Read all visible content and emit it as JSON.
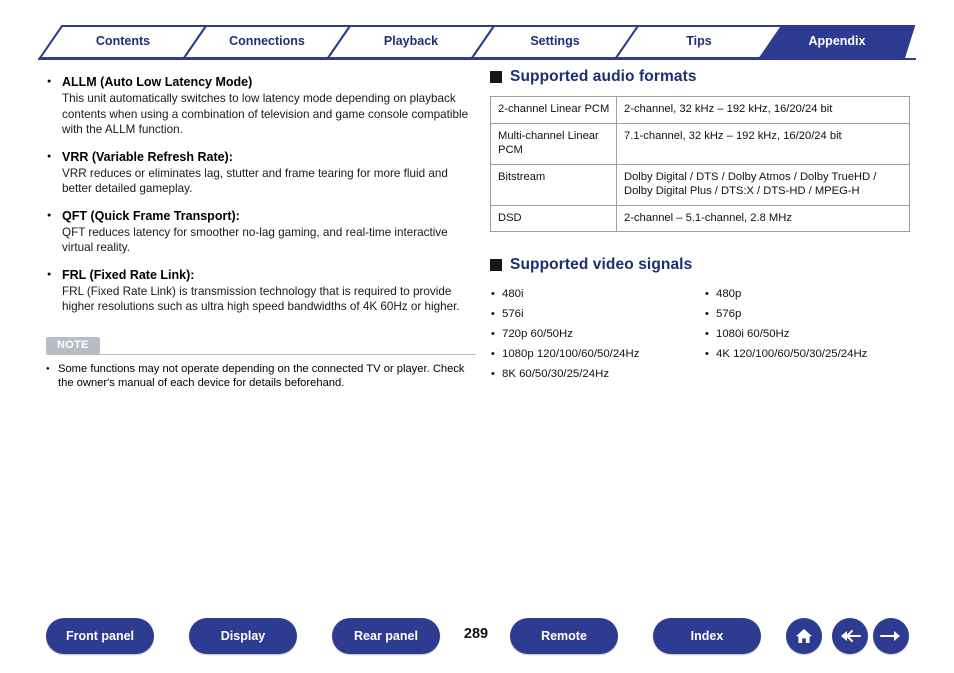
{
  "tabs": [
    {
      "label": "Contents",
      "active": false
    },
    {
      "label": "Connections",
      "active": false
    },
    {
      "label": "Playback",
      "active": false
    },
    {
      "label": "Settings",
      "active": false
    },
    {
      "label": "Tips",
      "active": false
    },
    {
      "label": "Appendix",
      "active": true
    }
  ],
  "left": {
    "bullets": [
      {
        "title": "ALLM (Auto Low Latency Mode)",
        "body": "This unit automatically switches to low latency mode depending on playback contents when using a combination of television and game console compatible with the ALLM function."
      },
      {
        "title": "VRR (Variable Refresh Rate):",
        "body": "VRR reduces or eliminates lag, stutter and frame tearing for more fluid and better detailed gameplay."
      },
      {
        "title": "QFT (Quick Frame Transport):",
        "body": "QFT reduces latency for smoother no-lag gaming, and real-time interactive virtual reality."
      },
      {
        "title": "FRL (Fixed Rate Link):",
        "body": "FRL (Fixed Rate Link) is transmission technology that is required to provide higher resolutions such as ultra high speed bandwidths of 4K 60Hz or higher."
      }
    ],
    "note": {
      "badge": "NOTE",
      "items": [
        "Some functions may not operate depending on the connected TV or player. Check the owner's manual of each device for details beforehand."
      ]
    }
  },
  "right": {
    "audio": {
      "heading": "Supported audio formats",
      "rows": [
        {
          "name": "2-channel Linear PCM",
          "value": "2-channel, 32 kHz – 192 kHz, 16/20/24 bit"
        },
        {
          "name": "Multi-channel Linear PCM",
          "value": "7.1-channel, 32 kHz – 192 kHz, 16/20/24 bit"
        },
        {
          "name": "Bitstream",
          "value": "Dolby Digital / DTS / Dolby Atmos / Dolby TrueHD / Dolby Digital Plus / DTS:X / DTS-HD / MPEG-H"
        },
        {
          "name": "DSD",
          "value": "2-channel – 5.1-channel, 2.8 MHz"
        }
      ]
    },
    "video": {
      "heading": "Supported video signals",
      "col1": [
        "480i",
        "576i",
        "720p 60/50Hz",
        "1080p 120/100/60/50/24Hz",
        "8K 60/50/30/25/24Hz"
      ],
      "col2": [
        "480p",
        "576p",
        "1080i 60/50Hz",
        "4K 120/100/60/50/30/25/24Hz"
      ]
    }
  },
  "footer": {
    "buttons": [
      {
        "label": "Front panel"
      },
      {
        "label": "Display"
      },
      {
        "label": "Rear panel"
      },
      {
        "label": "Remote"
      },
      {
        "label": "Index"
      }
    ],
    "page": "289",
    "icons": [
      {
        "name": "home-icon",
        "glyph": "⌂"
      },
      {
        "name": "back-arrow-icon",
        "glyph": "←"
      },
      {
        "name": "forward-arrow-icon",
        "glyph": "→"
      }
    ]
  },
  "colors": {
    "brand": "#2d3c91",
    "heading": "#1b2f72",
    "note_gray": "#b9bcc4"
  }
}
